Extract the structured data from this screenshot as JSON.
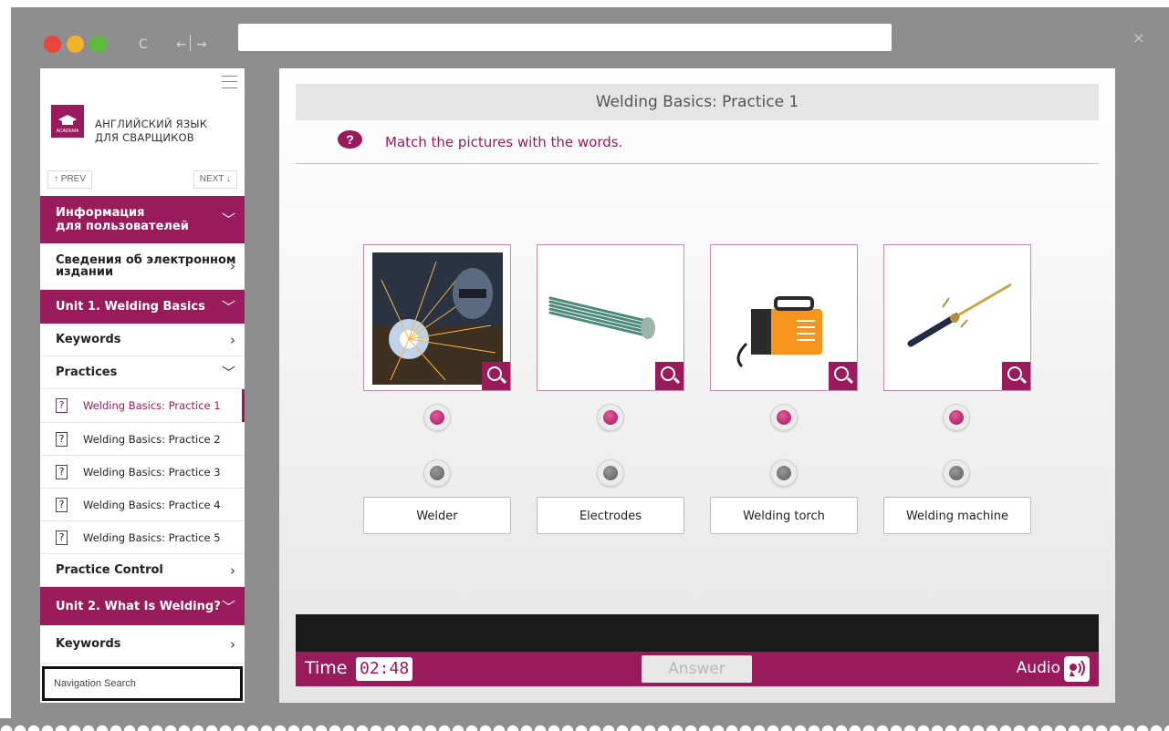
{
  "browser": {
    "reload_glyph": "C",
    "back_glyph": "←",
    "forward_glyph": "→",
    "close_glyph": "×"
  },
  "sidebar": {
    "logo_line1": "АНГЛИЙСКИЙ ЯЗЫК",
    "logo_line2": "ДЛЯ СВАРЩИКОВ",
    "logo_mark": "ACADEMA",
    "prev_label": "↑ PREV",
    "next_label": "NEXT ↓",
    "sections": [
      {
        "label1": "Информация",
        "label2": "для пользователей"
      },
      {
        "label1": "Сведения об электронном",
        "label2": "издании"
      },
      {
        "label1": "Unit 1. Welding Basics"
      },
      {
        "label1": "Keywords"
      },
      {
        "label1": "Practices"
      },
      {
        "label1": "Practice Control"
      },
      {
        "label1": "Unit 2. What Is Welding?"
      },
      {
        "label1": "Keywords"
      }
    ],
    "practices": [
      "Welding Basics: Practice 1",
      "Welding Basics: Practice 2",
      "Welding Basics: Practice 3",
      "Welding Basics: Practice 4",
      "Welding Basics: Practice 5"
    ],
    "question_glyph": "?",
    "search_placeholder": "Navigation Search"
  },
  "main": {
    "title": "Welding Basics: Practice 1",
    "instruction": "Match the pictures with the words.",
    "question_icon": "?",
    "cards": [
      "welder-photo",
      "electrodes-photo",
      "welding-machine-photo",
      "welding-torch-photo"
    ],
    "words": [
      "Welder",
      "Electrodes",
      "Welding torch",
      "Welding machine"
    ],
    "time_label": "Time",
    "time_value": "02:48",
    "answer_label": "Answer",
    "audio_label": "Audio",
    "audio_icon": "speaker-icon"
  },
  "colors": {
    "accent": "#9a1b5c",
    "chrome": "#8e8e8e"
  }
}
